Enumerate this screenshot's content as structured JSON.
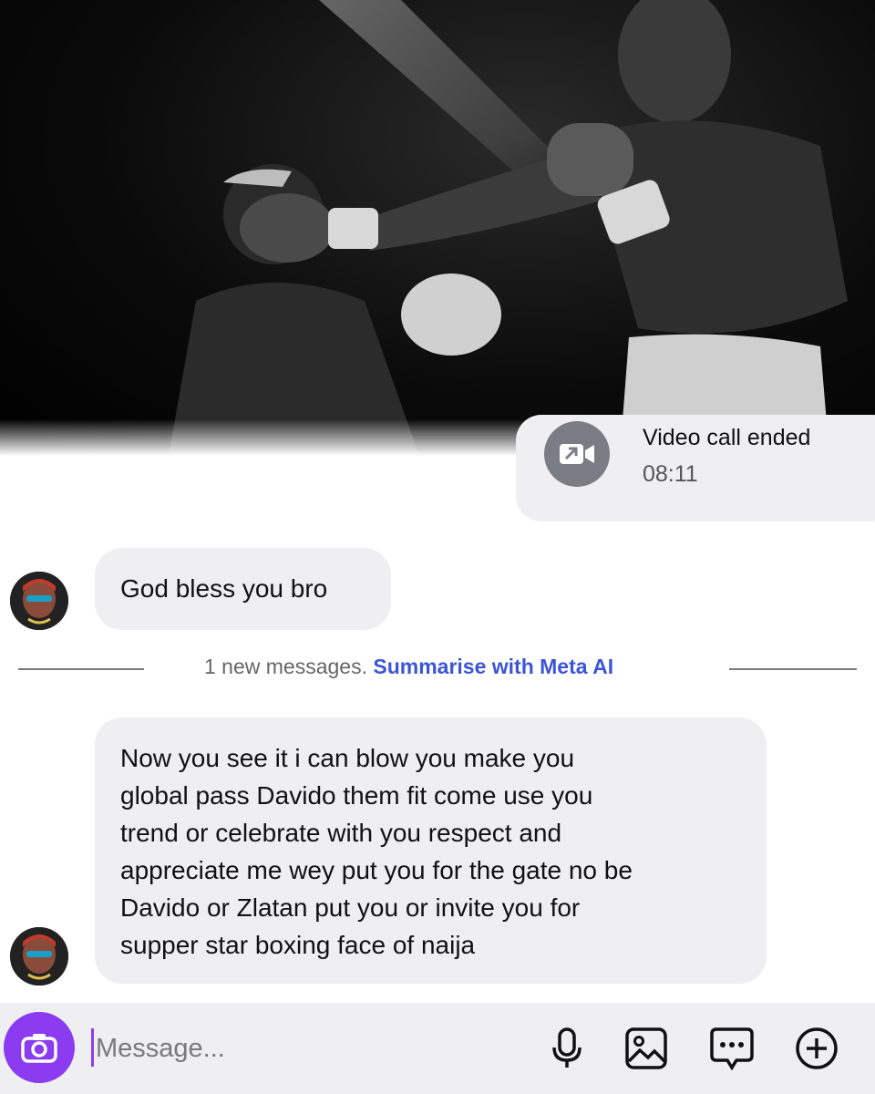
{
  "call": {
    "title": "Video call ended",
    "time": "08:11",
    "icon": "video-call-ended-icon"
  },
  "messages": [
    {
      "text": "God bless you bro"
    },
    {
      "lines": [
        "Now you see it i can blow you make you",
        "global pass Davido them fit come use you",
        "trend or celebrate with you respect and",
        "appreciate me wey put you for the gate no be",
        "Davido or Zlatan put you or invite you for",
        "supper star boxing face of naija"
      ]
    }
  ],
  "divider": {
    "text": "1 new messages.",
    "link": "Summarise with Meta AI"
  },
  "composer": {
    "placeholder": "Message...",
    "icons": [
      "camera-icon",
      "microphone-icon",
      "gallery-icon",
      "sticker-icon",
      "plus-icon"
    ]
  },
  "colors": {
    "accent": "#8b3cf0",
    "link": "#3c55d6",
    "bubble": "#efeff2"
  }
}
